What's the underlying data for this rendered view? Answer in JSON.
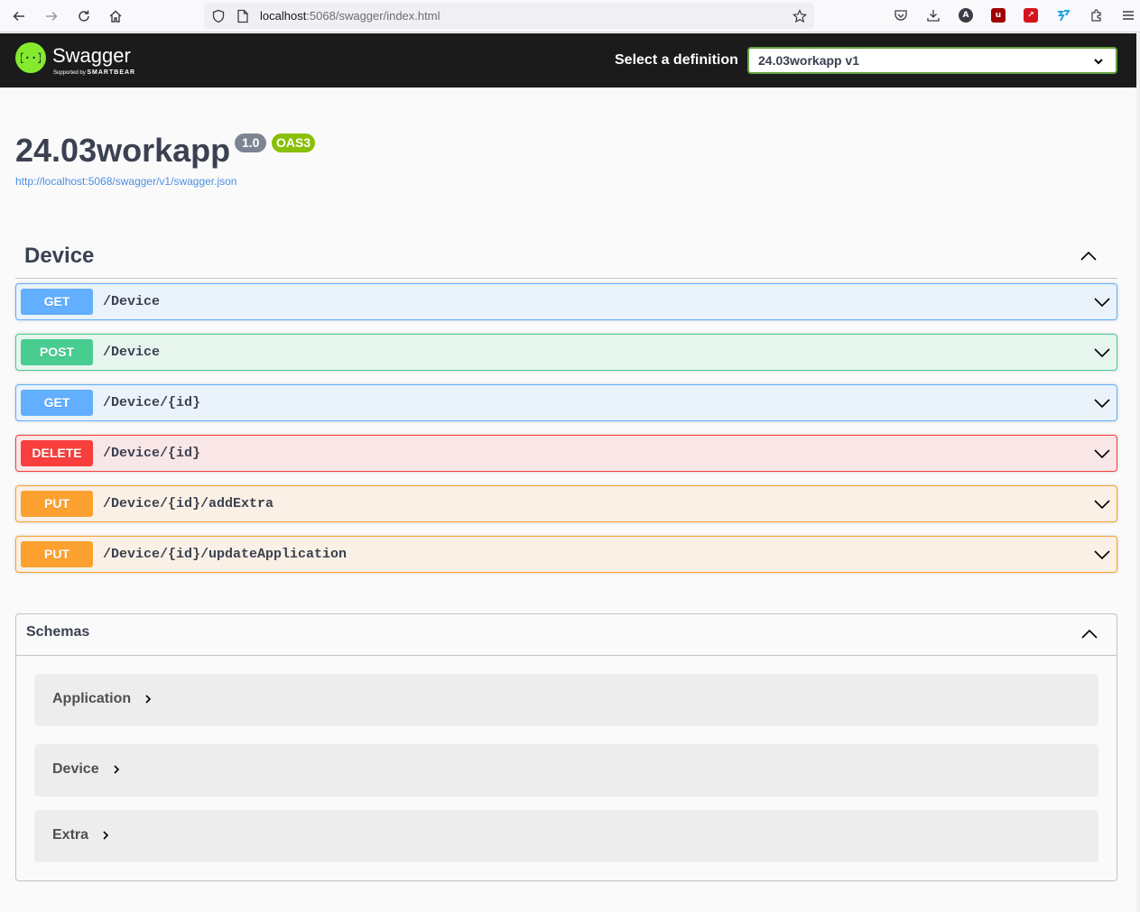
{
  "browser": {
    "url_host": "localhost",
    "url_rest": ":5068/swagger/index.html",
    "icons": [
      "back-icon",
      "forward-icon",
      "reload-icon",
      "home-icon",
      "shield-icon",
      "page-icon",
      "star-icon",
      "pocket-icon",
      "download-icon",
      "account-icon",
      "ublock-icon",
      "pdf-icon",
      "extension-icon",
      "puzzle-icon",
      "menu-icon"
    ]
  },
  "topbar": {
    "logo_text": "Swagger",
    "logo_supported": "Supported by",
    "logo_brand": "SMARTBEAR",
    "definition_label": "Select a definition",
    "definition_value": "24.03workapp v1"
  },
  "info": {
    "title": "24.03workapp",
    "version": "1.0",
    "oas": "OAS3",
    "spec_url": "http://localhost:5068/swagger/v1/swagger.json"
  },
  "tag": {
    "name": "Device"
  },
  "operations": [
    {
      "method": "GET",
      "path": "/Device"
    },
    {
      "method": "POST",
      "path": "/Device"
    },
    {
      "method": "GET",
      "path": "/Device/{id}"
    },
    {
      "method": "DELETE",
      "path": "/Device/{id}"
    },
    {
      "method": "PUT",
      "path": "/Device/{id}/addExtra"
    },
    {
      "method": "PUT",
      "path": "/Device/{id}/updateApplication"
    }
  ],
  "schemas": {
    "title": "Schemas",
    "models": [
      "Application",
      "Device",
      "Extra"
    ]
  },
  "colors": {
    "get": "#61affe",
    "post": "#49cc90",
    "delete": "#f93e3e",
    "put": "#fca130",
    "topbar": "#1b1b1b",
    "logo": "#85ea2d"
  }
}
